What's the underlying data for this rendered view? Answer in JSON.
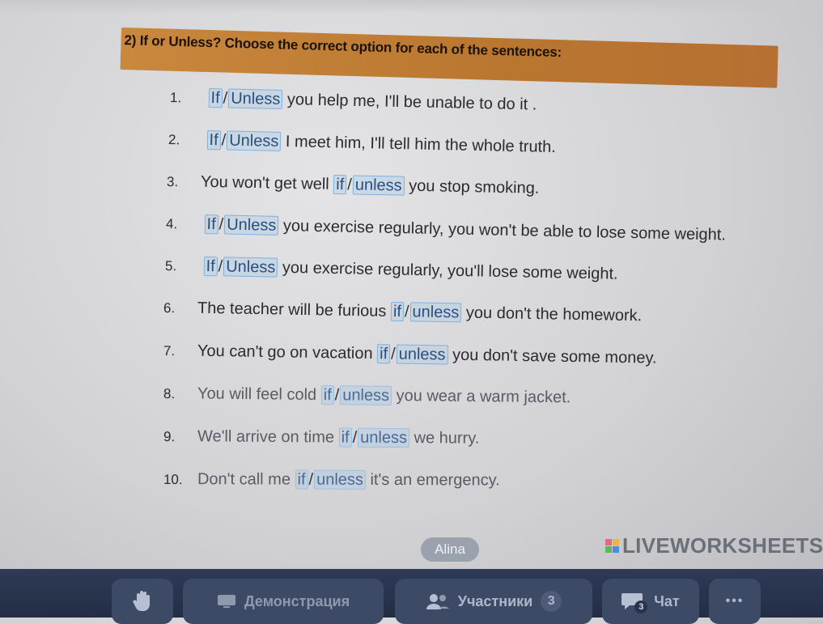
{
  "worksheet": {
    "title": "2) If or Unless? Choose the correct option for each of the sentences:",
    "items": [
      {
        "num": "1.",
        "before": "",
        "opt1": "If",
        "opt2": "Unless",
        "after": "you help me, I'll be unable to do it ."
      },
      {
        "num": "2.",
        "before": "",
        "opt1": "If",
        "opt2": "Unless",
        "after": "I meet him, I'll tell him the whole truth."
      },
      {
        "num": "3.",
        "before": "You won't get well",
        "opt1": "if",
        "opt2": "unless",
        "after": "you stop smoking."
      },
      {
        "num": "4.",
        "before": "",
        "opt1": "If",
        "opt2": "Unless",
        "after": "you exercise regularly, you won't be able to lose some weight."
      },
      {
        "num": "5.",
        "before": "",
        "opt1": "If",
        "opt2": "Unless",
        "after": "you exercise regularly, you'll lose some weight."
      },
      {
        "num": "6.",
        "before": "The teacher will be furious",
        "opt1": "if",
        "opt2": "unless",
        "after": "you don't the homework."
      },
      {
        "num": "7.",
        "before": "You can't go on vacation",
        "opt1": "if",
        "opt2": "unless",
        "after": "you don't save some money."
      },
      {
        "num": "8.",
        "before": "You will feel cold",
        "opt1": "if",
        "opt2": "unless",
        "after": "you wear a warm jacket."
      },
      {
        "num": "9.",
        "before": "We'll arrive on time",
        "opt1": "if",
        "opt2": "unless",
        "after": "we hurry."
      },
      {
        "num": "10.",
        "before": "Don't call me",
        "opt1": "if",
        "opt2": "unless",
        "after": "it's an emergency."
      }
    ],
    "separator": "/",
    "author": "Alina",
    "brand": "LIVEWORKSHEETS"
  },
  "toolbar": {
    "raise_hand_icon": "hand-icon",
    "screen_share_label": "Демонстрация",
    "participants_label": "Участники",
    "participants_count": "3",
    "chat_label": "Чат",
    "chat_badge": "3",
    "more_label": "•••"
  },
  "colors": {
    "title_bar": "#c9883e",
    "option_border": "#7fb1de",
    "toolbar_bg": "#2e3a56",
    "toolbar_button": "#3d4a66"
  }
}
